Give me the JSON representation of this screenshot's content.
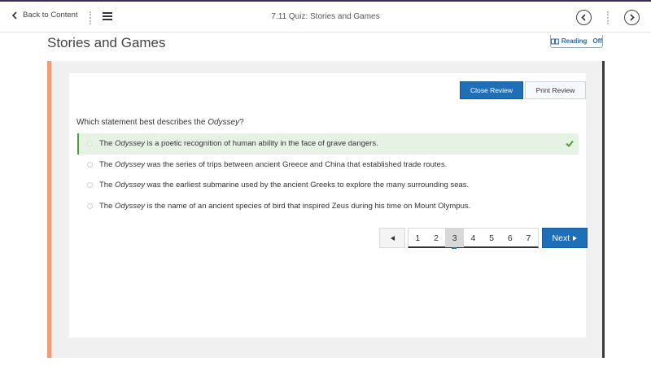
{
  "topbar": {
    "back_label": "Back to Content",
    "quiz_title": "7.11 Quiz: Stories and Games"
  },
  "page": {
    "heading": "Stories and Games",
    "reading_label": "Reading",
    "reading_state": "Off"
  },
  "review": {
    "close_label": "Close Review",
    "print_label": "Print Review"
  },
  "question": {
    "prefix": "Which statement best describes the ",
    "title_italic": "Odyssey",
    "suffix": "?"
  },
  "answers": [
    {
      "pre": "The ",
      "em": "Odyssey",
      "post": " is a poetic recognition of human ability in the face of grave dangers.",
      "correct": true
    },
    {
      "pre": "The ",
      "em": "Odyssey",
      "post": " was the series of trips between ancient Greece and China that established trade routes.",
      "correct": false
    },
    {
      "pre": "The ",
      "em": "Odyssey",
      "post": " was the earliest submarine used by the ancient Greeks to explore the many surrounding seas.",
      "correct": false
    },
    {
      "pre": "The ",
      "em": "Odyssey",
      "post": " is the name of an ancient species of bird that inspired Zeus during his time on Mount Olympus.",
      "correct": false
    }
  ],
  "pagination": {
    "pages": [
      "1",
      "2",
      "3",
      "4",
      "5",
      "6",
      "7"
    ],
    "current": "3",
    "next_label": "Next"
  },
  "colors": {
    "accent": "#1f6fb8",
    "correct_bg": "#e6f3e4",
    "correct_check": "#4f9a3a",
    "side_bar": "#f19a76"
  }
}
